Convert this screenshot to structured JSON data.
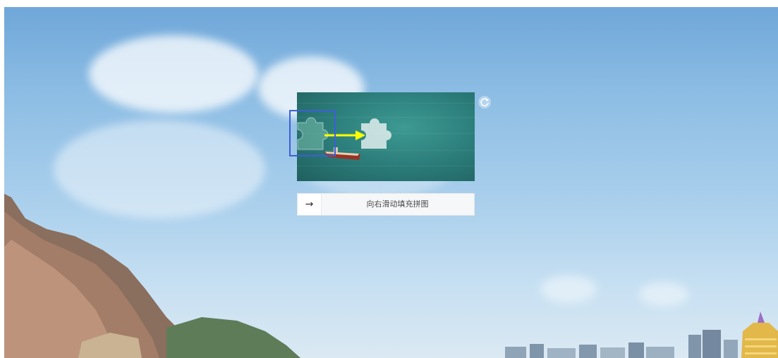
{
  "captcha": {
    "hint_text": "向右滑动填充拼图",
    "arrow_glyph": "→",
    "refresh_icon": "refresh-icon",
    "piece_icon": "puzzle-piece-icon",
    "boat_icon": "boat-icon"
  },
  "colors": {
    "highlight_border": "#3d5fd6",
    "arrow_annotation": "#ffff00",
    "slider_bg": "#f6f7f8"
  }
}
